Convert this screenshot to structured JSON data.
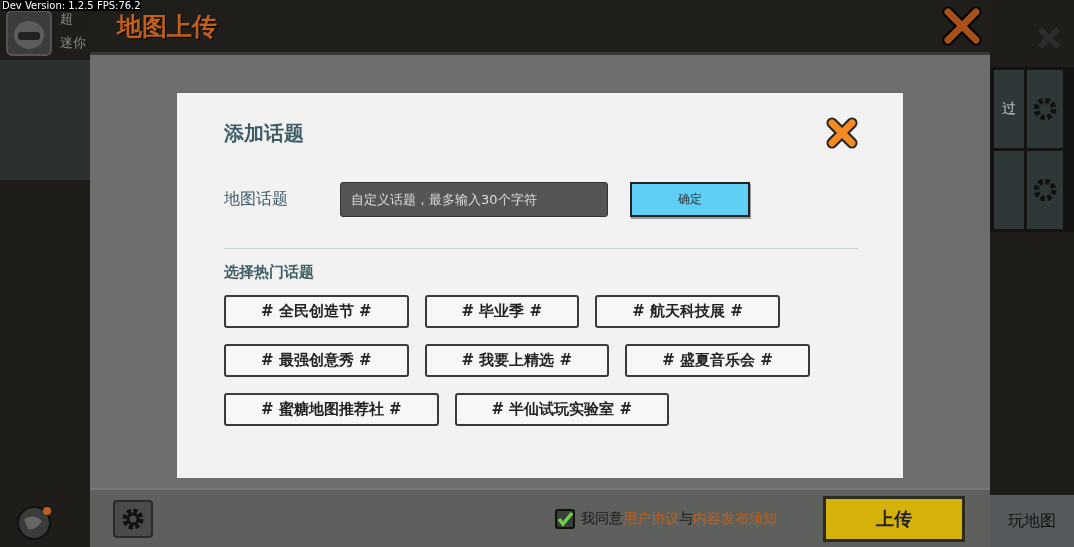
{
  "dev_overlay": "Dev Version: 1.2.5  FPS:76.2",
  "profile": {
    "name": "超",
    "subtitle": "迷你"
  },
  "upload_panel": {
    "title": "地图上传"
  },
  "dialog": {
    "title": "添加话题",
    "topic_label": "地图话题",
    "topic_field": {
      "placeholder": "自定义话题，最多输入30个字符"
    },
    "confirm_button": "确定",
    "hot_topics_label": "选择热门话题",
    "hot_topics": [
      "# 全民创造节 #",
      "# 毕业季 #",
      "# 航天科技展 #",
      "# 最强创意秀 #",
      "# 我要上精选 #",
      "# 盛夏音乐会 #",
      "# 蜜糖地图推荐社 #",
      "# 半仙试玩实验室 #"
    ]
  },
  "agreement": {
    "checked": true,
    "parts": [
      {
        "text": "我同意",
        "kind": "plain"
      },
      {
        "text": "用户协议",
        "kind": "link"
      },
      {
        "text": "与",
        "kind": "plain"
      },
      {
        "text": "内容发布须知",
        "kind": "link"
      }
    ]
  },
  "upload_button": "上传",
  "side_panel": {
    "tile_label": "过",
    "bottom_label": "玩地图"
  }
}
